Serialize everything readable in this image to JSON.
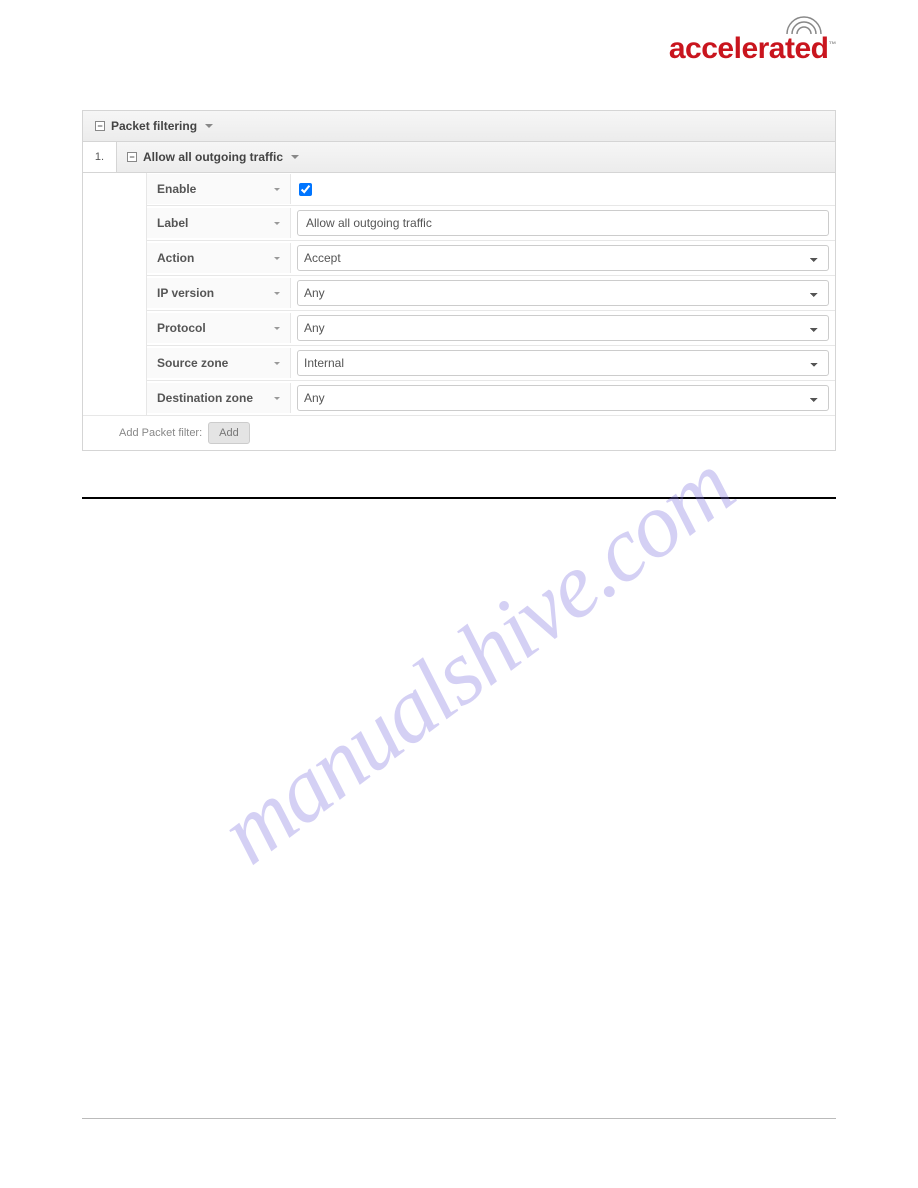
{
  "logo": {
    "text": "accelerated",
    "tm": "™"
  },
  "panel": {
    "title": "Packet filtering",
    "rule": {
      "index": "1.",
      "title": "Allow all outgoing traffic",
      "fields": {
        "enable": {
          "label": "Enable",
          "checked": true
        },
        "label": {
          "label": "Label",
          "value": "Allow all outgoing traffic"
        },
        "action": {
          "label": "Action",
          "value": "Accept"
        },
        "ip_version": {
          "label": "IP version",
          "value": "Any"
        },
        "protocol": {
          "label": "Protocol",
          "value": "Any"
        },
        "source_zone": {
          "label": "Source zone",
          "value": "Internal"
        },
        "destination_zone": {
          "label": "Destination zone",
          "value": "Any"
        }
      }
    },
    "add": {
      "prompt": "Add Packet filter:",
      "button": "Add"
    }
  },
  "watermark": "manualshive.com"
}
